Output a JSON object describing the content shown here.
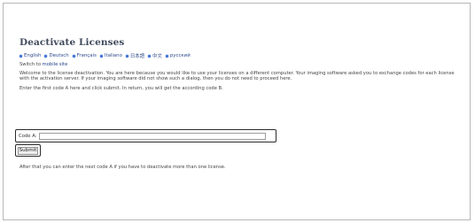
{
  "page": {
    "title": "Deactivate Licenses"
  },
  "languages": [
    "English",
    "Deutsch",
    "Français",
    "Italiano",
    "日本語",
    "中文",
    "русский"
  ],
  "switch": {
    "prefix": "Switch to ",
    "link": "mobile site"
  },
  "text": {
    "intro": "Welcome to the license deactivation. You are here because you would like to use your licenses on a different computer. Your imaging software asked you to exchange codes for each license with the activation server. If your imaging software did not show such a dialog, then you do not need to proceed here.",
    "instruction": "Enter the first code A here and click submit. In return, you will get the according code B.",
    "after": "After that you can enter the next code A if you have to deactivate more than one license."
  },
  "form": {
    "code_label": "Code A:",
    "code_value": "",
    "submit_label": "Submit"
  },
  "colors": {
    "title": "#404a5c",
    "link": "#1f3f8a",
    "bullet": "#3d6fd3",
    "border": "#b7b7b7"
  }
}
